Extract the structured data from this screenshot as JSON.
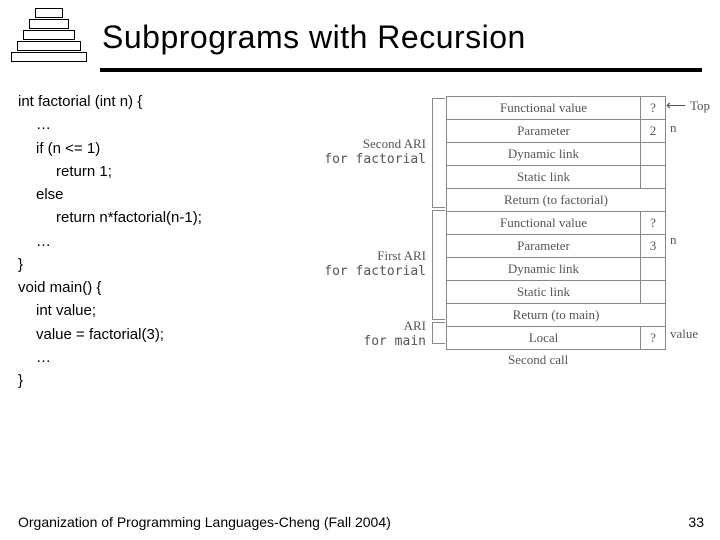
{
  "header": {
    "title": "Subprograms with Recursion",
    "pyramid": [
      "",
      "",
      "",
      "",
      ""
    ]
  },
  "code": {
    "l0": "int factorial (int n) {",
    "l1": "…",
    "l2": "if (n <= 1)",
    "l3": "return 1;",
    "l4": "else",
    "l5": "return n*factorial(n-1);",
    "l6": "…",
    "l7": "}",
    "l8": "void main() {",
    "l9": "int value;",
    "l10": "value = factorial(3);",
    "l11": "…",
    "l12": "}"
  },
  "diagram": {
    "labels": {
      "ari2a": "Second ARI",
      "ari2b": "for factorial",
      "ari1a": "First ARI",
      "ari1b": "for factorial",
      "arimA": "ARI",
      "arimB": "for main",
      "top": "Top",
      "n1": "n",
      "n2": "n",
      "value": "value",
      "caption": "Second call"
    },
    "stack": [
      {
        "a": "Functional value",
        "b": "?"
      },
      {
        "a": "Parameter",
        "b": "2"
      },
      {
        "a": "Dynamic link",
        "b": ""
      },
      {
        "a": "Static link",
        "b": ""
      },
      {
        "a": "Return (to factorial)",
        "full": true
      },
      {
        "a": "Functional value",
        "b": "?"
      },
      {
        "a": "Parameter",
        "b": "3"
      },
      {
        "a": "Dynamic link",
        "b": ""
      },
      {
        "a": "Static link",
        "b": ""
      },
      {
        "a": "Return (to main)",
        "full": true
      },
      {
        "a": "Local",
        "b": "?"
      }
    ]
  },
  "footer": {
    "text": "Organization of Programming Languages-Cheng (Fall 2004)",
    "page": "33"
  }
}
